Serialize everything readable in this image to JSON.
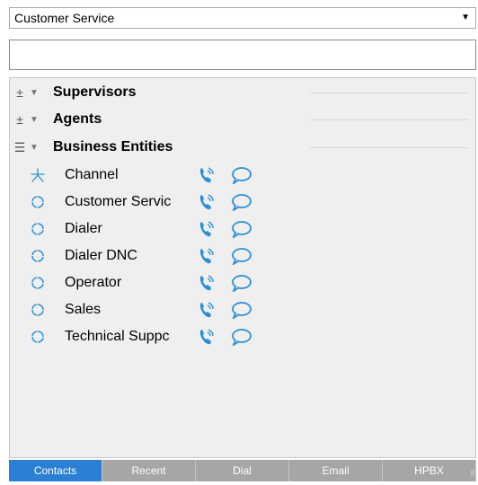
{
  "queue_selector": {
    "selected": "Customer Service"
  },
  "search": {
    "value": ""
  },
  "groups": [
    {
      "label": "Supervisors",
      "state": "collapsed"
    },
    {
      "label": "Agents",
      "state": "collapsed"
    },
    {
      "label": "Business Entities",
      "state": "expanded"
    }
  ],
  "entities": [
    {
      "label": "Channel",
      "icon": "channel-icon"
    },
    {
      "label": "Customer Servic",
      "icon": "queue-icon"
    },
    {
      "label": "Dialer",
      "icon": "queue-icon"
    },
    {
      "label": "Dialer DNC",
      "icon": "queue-icon"
    },
    {
      "label": "Operator",
      "icon": "queue-icon"
    },
    {
      "label": "Sales",
      "icon": "queue-icon"
    },
    {
      "label": "Technical Suppc",
      "icon": "queue-icon"
    }
  ],
  "tabs": [
    {
      "label": "Contacts",
      "active": true
    },
    {
      "label": "Recent"
    },
    {
      "label": "Dial"
    },
    {
      "label": "Email"
    },
    {
      "label": "HPBX"
    }
  ],
  "colors": {
    "accent": "#2b7fd4",
    "tab_bg": "#a6a6a6",
    "panel_bg": "#efefef",
    "icon_blue": "#2b8fd6"
  }
}
